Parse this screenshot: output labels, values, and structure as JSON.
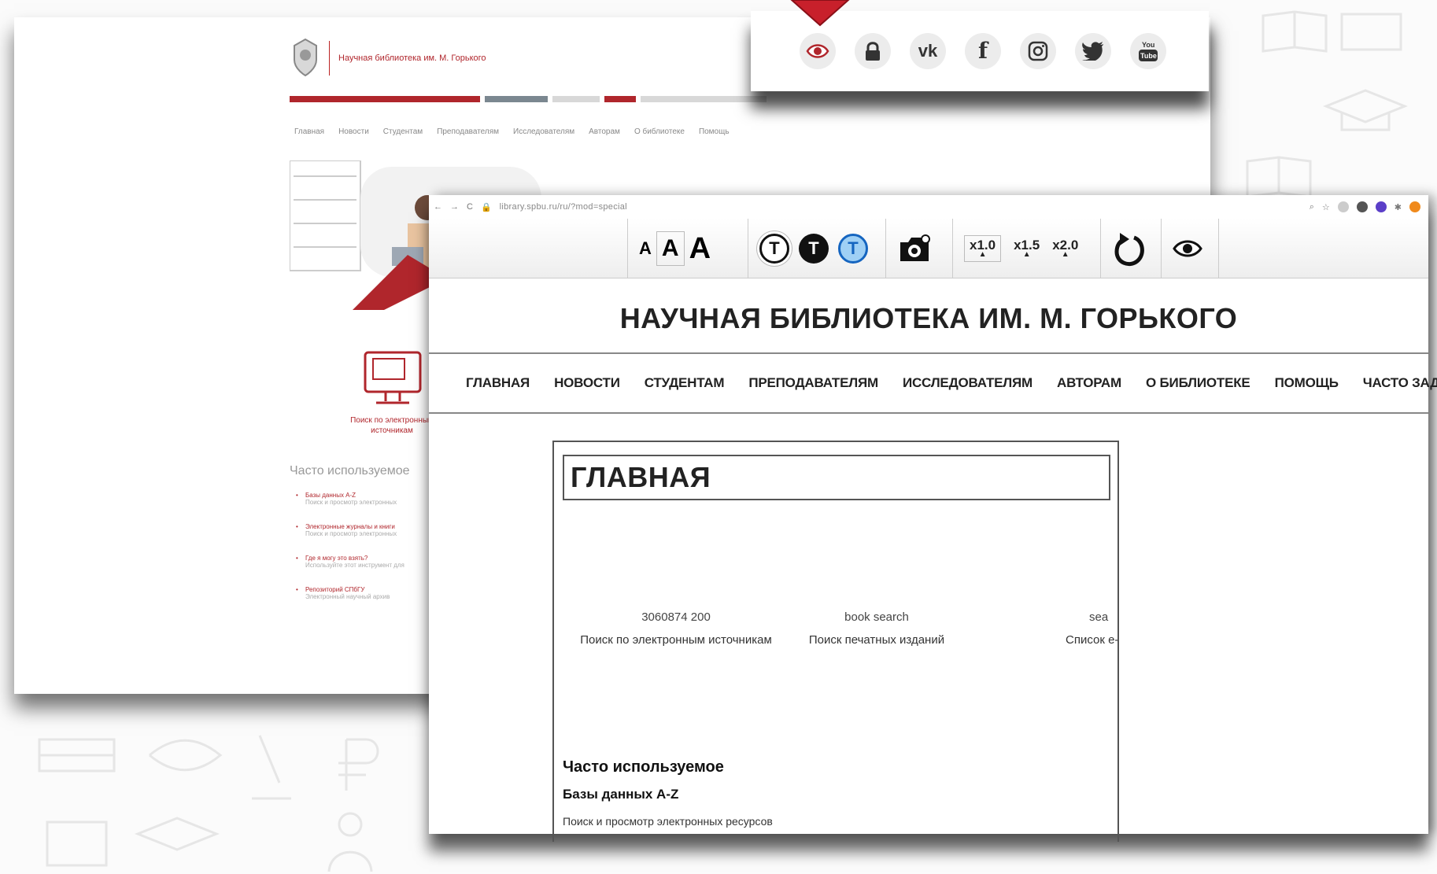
{
  "back_site": {
    "logo_text": "Научная библиотека им. М. Горького",
    "nav": [
      "Главная",
      "Новости",
      "Студентам",
      "Преподавателям",
      "Исследователям",
      "Авторам",
      "О библиотеке",
      "Помощь"
    ],
    "search_label": "Поиск по электронным источникам",
    "frequent_title": "Часто используемое",
    "frequent_items": [
      {
        "title": "Базы данных A-Z",
        "desc": "Поиск и просмотр электронных"
      },
      {
        "title": "Электронные журналы и книги",
        "desc": "Поиск и просмотр электронных"
      },
      {
        "title": "Где я могу это взять?",
        "desc": "Используйте этот инструмент для"
      },
      {
        "title": "Репозиторий СПбГУ",
        "desc": "Электронный научный архив"
      }
    ],
    "brand_color": "#b0262c"
  },
  "social": {
    "icons": [
      {
        "name": "eye-icon",
        "glyph": "👁",
        "color": "#b0262c"
      },
      {
        "name": "lock-icon",
        "glyph": "🔒",
        "color": "#333"
      },
      {
        "name": "vk-icon",
        "glyph": "ʁ",
        "color": "#333"
      },
      {
        "name": "facebook-icon",
        "glyph": "f",
        "color": "#333"
      },
      {
        "name": "instagram-icon",
        "glyph": "◎",
        "color": "#333"
      },
      {
        "name": "twitter-icon",
        "glyph": "🐦",
        "color": "#333"
      },
      {
        "name": "youtube-icon",
        "glyph": "▶",
        "color": "#333"
      }
    ]
  },
  "browser": {
    "url": "library.spbu.ru/ru/?mod=special"
  },
  "toolbar": {
    "font_sizes": [
      "A",
      "A",
      "A"
    ],
    "theme_letters": [
      "T",
      "T",
      "T"
    ],
    "zoom": [
      {
        "label": "x1.0"
      },
      {
        "label": "x1.5"
      },
      {
        "label": "x2.0"
      }
    ]
  },
  "front_site": {
    "title": "НАУЧНАЯ БИБЛИОТЕКА ИМ. М. ГОРЬКОГО",
    "nav": [
      "ГЛАВНАЯ",
      "НОВОСТИ",
      "СТУДЕНТАМ",
      "ПРЕПОДАВАТЕЛЯМ",
      "ИССЛЕДОВАТЕЛЯМ",
      "АВТОРАМ",
      "О БИБЛИОТЕКЕ",
      "ПОМОЩЬ",
      "ЧАСТО ЗАДАВАЕМЫЕ ВОПРОСЫ"
    ],
    "page_heading": "ГЛАВНАЯ",
    "tiles": [
      {
        "alt": "3060874 200",
        "label": "Поиск по электронным источникам"
      },
      {
        "alt": "book search",
        "label": "Поиск печатных изданий"
      },
      {
        "alt": "sea",
        "label": "Список е-р"
      }
    ],
    "frequent_title": "Часто используемое",
    "frequent_first": "Базы данных A-Z",
    "frequent_first_desc": "Поиск и просмотр электронных ресурсов"
  }
}
